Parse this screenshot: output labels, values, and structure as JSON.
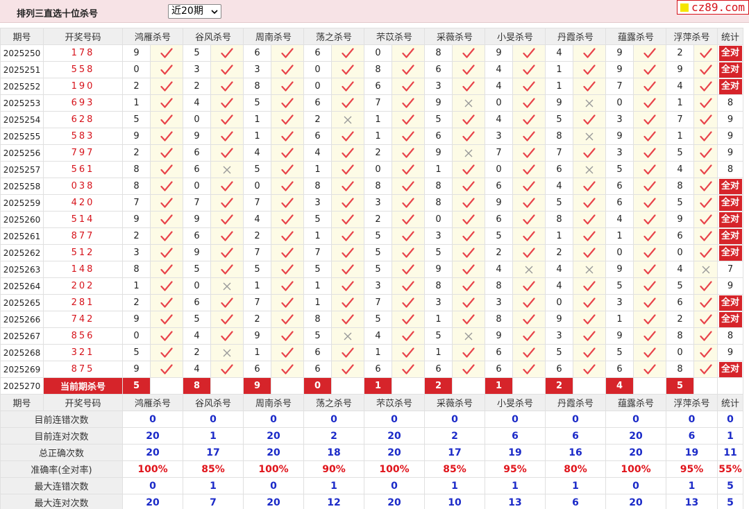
{
  "header": {
    "title": "排列三直选十位杀号",
    "range_selected": "近20期",
    "site_badge": "cz89.com"
  },
  "columns": {
    "period": "期号",
    "winning": "开奖号码",
    "killers": [
      "鸿雁杀号",
      "谷风杀号",
      "周南杀号",
      "荡之杀号",
      "芣苡杀号",
      "采薇杀号",
      "小旻杀号",
      "丹霞杀号",
      "蕴露杀号",
      "浮萍杀号"
    ],
    "stats": "统计"
  },
  "all_right_label": "全对",
  "rows": [
    {
      "period": "2025250",
      "winning": "178",
      "kills": [
        {
          "n": "9",
          "ok": true
        },
        {
          "n": "5",
          "ok": true
        },
        {
          "n": "6",
          "ok": true
        },
        {
          "n": "6",
          "ok": true
        },
        {
          "n": "0",
          "ok": true
        },
        {
          "n": "8",
          "ok": true
        },
        {
          "n": "9",
          "ok": true
        },
        {
          "n": "4",
          "ok": true
        },
        {
          "n": "9",
          "ok": true
        },
        {
          "n": "2",
          "ok": true
        }
      ],
      "stat": "全对"
    },
    {
      "period": "2025251",
      "winning": "558",
      "kills": [
        {
          "n": "0",
          "ok": true
        },
        {
          "n": "3",
          "ok": true
        },
        {
          "n": "3",
          "ok": true
        },
        {
          "n": "0",
          "ok": true
        },
        {
          "n": "8",
          "ok": true
        },
        {
          "n": "6",
          "ok": true
        },
        {
          "n": "4",
          "ok": true
        },
        {
          "n": "1",
          "ok": true
        },
        {
          "n": "9",
          "ok": true
        },
        {
          "n": "9",
          "ok": true
        }
      ],
      "stat": "全对"
    },
    {
      "period": "2025252",
      "winning": "190",
      "kills": [
        {
          "n": "2",
          "ok": true
        },
        {
          "n": "2",
          "ok": true
        },
        {
          "n": "8",
          "ok": true
        },
        {
          "n": "0",
          "ok": true
        },
        {
          "n": "6",
          "ok": true
        },
        {
          "n": "3",
          "ok": true
        },
        {
          "n": "4",
          "ok": true
        },
        {
          "n": "1",
          "ok": true
        },
        {
          "n": "7",
          "ok": true
        },
        {
          "n": "4",
          "ok": true
        }
      ],
      "stat": "全对"
    },
    {
      "period": "2025253",
      "winning": "693",
      "kills": [
        {
          "n": "1",
          "ok": true
        },
        {
          "n": "4",
          "ok": true
        },
        {
          "n": "5",
          "ok": true
        },
        {
          "n": "6",
          "ok": true
        },
        {
          "n": "7",
          "ok": true
        },
        {
          "n": "9",
          "ok": false
        },
        {
          "n": "0",
          "ok": true
        },
        {
          "n": "9",
          "ok": false
        },
        {
          "n": "0",
          "ok": true
        },
        {
          "n": "1",
          "ok": true
        }
      ],
      "stat": "8"
    },
    {
      "period": "2025254",
      "winning": "628",
      "kills": [
        {
          "n": "5",
          "ok": true
        },
        {
          "n": "0",
          "ok": true
        },
        {
          "n": "1",
          "ok": true
        },
        {
          "n": "2",
          "ok": false
        },
        {
          "n": "1",
          "ok": true
        },
        {
          "n": "5",
          "ok": true
        },
        {
          "n": "4",
          "ok": true
        },
        {
          "n": "5",
          "ok": true
        },
        {
          "n": "3",
          "ok": true
        },
        {
          "n": "7",
          "ok": true
        }
      ],
      "stat": "9"
    },
    {
      "period": "2025255",
      "winning": "583",
      "kills": [
        {
          "n": "9",
          "ok": true
        },
        {
          "n": "9",
          "ok": true
        },
        {
          "n": "1",
          "ok": true
        },
        {
          "n": "6",
          "ok": true
        },
        {
          "n": "1",
          "ok": true
        },
        {
          "n": "6",
          "ok": true
        },
        {
          "n": "3",
          "ok": true
        },
        {
          "n": "8",
          "ok": false
        },
        {
          "n": "9",
          "ok": true
        },
        {
          "n": "1",
          "ok": true
        }
      ],
      "stat": "9"
    },
    {
      "period": "2025256",
      "winning": "797",
      "kills": [
        {
          "n": "2",
          "ok": true
        },
        {
          "n": "6",
          "ok": true
        },
        {
          "n": "4",
          "ok": true
        },
        {
          "n": "4",
          "ok": true
        },
        {
          "n": "2",
          "ok": true
        },
        {
          "n": "9",
          "ok": false
        },
        {
          "n": "7",
          "ok": true
        },
        {
          "n": "7",
          "ok": true
        },
        {
          "n": "3",
          "ok": true
        },
        {
          "n": "5",
          "ok": true
        }
      ],
      "stat": "9"
    },
    {
      "period": "2025257",
      "winning": "561",
      "kills": [
        {
          "n": "8",
          "ok": true
        },
        {
          "n": "6",
          "ok": false
        },
        {
          "n": "5",
          "ok": true
        },
        {
          "n": "1",
          "ok": true
        },
        {
          "n": "0",
          "ok": true
        },
        {
          "n": "1",
          "ok": true
        },
        {
          "n": "0",
          "ok": true
        },
        {
          "n": "6",
          "ok": false
        },
        {
          "n": "5",
          "ok": true
        },
        {
          "n": "4",
          "ok": true
        }
      ],
      "stat": "8"
    },
    {
      "period": "2025258",
      "winning": "038",
      "kills": [
        {
          "n": "8",
          "ok": true
        },
        {
          "n": "0",
          "ok": true
        },
        {
          "n": "0",
          "ok": true
        },
        {
          "n": "8",
          "ok": true
        },
        {
          "n": "8",
          "ok": true
        },
        {
          "n": "8",
          "ok": true
        },
        {
          "n": "6",
          "ok": true
        },
        {
          "n": "4",
          "ok": true
        },
        {
          "n": "6",
          "ok": true
        },
        {
          "n": "8",
          "ok": true
        }
      ],
      "stat": "全对"
    },
    {
      "period": "2025259",
      "winning": "420",
      "kills": [
        {
          "n": "7",
          "ok": true
        },
        {
          "n": "7",
          "ok": true
        },
        {
          "n": "7",
          "ok": true
        },
        {
          "n": "3",
          "ok": true
        },
        {
          "n": "3",
          "ok": true
        },
        {
          "n": "8",
          "ok": true
        },
        {
          "n": "9",
          "ok": true
        },
        {
          "n": "5",
          "ok": true
        },
        {
          "n": "6",
          "ok": true
        },
        {
          "n": "5",
          "ok": true
        }
      ],
      "stat": "全对"
    },
    {
      "period": "2025260",
      "winning": "514",
      "kills": [
        {
          "n": "9",
          "ok": true
        },
        {
          "n": "9",
          "ok": true
        },
        {
          "n": "4",
          "ok": true
        },
        {
          "n": "5",
          "ok": true
        },
        {
          "n": "2",
          "ok": true
        },
        {
          "n": "0",
          "ok": true
        },
        {
          "n": "6",
          "ok": true
        },
        {
          "n": "8",
          "ok": true
        },
        {
          "n": "4",
          "ok": true
        },
        {
          "n": "9",
          "ok": true
        }
      ],
      "stat": "全对"
    },
    {
      "period": "2025261",
      "winning": "877",
      "kills": [
        {
          "n": "2",
          "ok": true
        },
        {
          "n": "6",
          "ok": true
        },
        {
          "n": "2",
          "ok": true
        },
        {
          "n": "1",
          "ok": true
        },
        {
          "n": "5",
          "ok": true
        },
        {
          "n": "3",
          "ok": true
        },
        {
          "n": "5",
          "ok": true
        },
        {
          "n": "1",
          "ok": true
        },
        {
          "n": "1",
          "ok": true
        },
        {
          "n": "6",
          "ok": true
        }
      ],
      "stat": "全对"
    },
    {
      "period": "2025262",
      "winning": "512",
      "kills": [
        {
          "n": "3",
          "ok": true
        },
        {
          "n": "9",
          "ok": true
        },
        {
          "n": "7",
          "ok": true
        },
        {
          "n": "7",
          "ok": true
        },
        {
          "n": "5",
          "ok": true
        },
        {
          "n": "5",
          "ok": true
        },
        {
          "n": "2",
          "ok": true
        },
        {
          "n": "2",
          "ok": true
        },
        {
          "n": "0",
          "ok": true
        },
        {
          "n": "0",
          "ok": true
        }
      ],
      "stat": "全对"
    },
    {
      "period": "2025263",
      "winning": "148",
      "kills": [
        {
          "n": "8",
          "ok": true
        },
        {
          "n": "5",
          "ok": true
        },
        {
          "n": "5",
          "ok": true
        },
        {
          "n": "5",
          "ok": true
        },
        {
          "n": "5",
          "ok": true
        },
        {
          "n": "9",
          "ok": true
        },
        {
          "n": "4",
          "ok": false
        },
        {
          "n": "4",
          "ok": false
        },
        {
          "n": "9",
          "ok": true
        },
        {
          "n": "4",
          "ok": false
        }
      ],
      "stat": "7"
    },
    {
      "period": "2025264",
      "winning": "202",
      "kills": [
        {
          "n": "1",
          "ok": true
        },
        {
          "n": "0",
          "ok": false
        },
        {
          "n": "1",
          "ok": true
        },
        {
          "n": "1",
          "ok": true
        },
        {
          "n": "3",
          "ok": true
        },
        {
          "n": "8",
          "ok": true
        },
        {
          "n": "8",
          "ok": true
        },
        {
          "n": "4",
          "ok": true
        },
        {
          "n": "5",
          "ok": true
        },
        {
          "n": "5",
          "ok": true
        }
      ],
      "stat": "9"
    },
    {
      "period": "2025265",
      "winning": "281",
      "kills": [
        {
          "n": "2",
          "ok": true
        },
        {
          "n": "6",
          "ok": true
        },
        {
          "n": "7",
          "ok": true
        },
        {
          "n": "1",
          "ok": true
        },
        {
          "n": "7",
          "ok": true
        },
        {
          "n": "3",
          "ok": true
        },
        {
          "n": "3",
          "ok": true
        },
        {
          "n": "0",
          "ok": true
        },
        {
          "n": "3",
          "ok": true
        },
        {
          "n": "6",
          "ok": true
        }
      ],
      "stat": "全对"
    },
    {
      "period": "2025266",
      "winning": "742",
      "kills": [
        {
          "n": "9",
          "ok": true
        },
        {
          "n": "5",
          "ok": true
        },
        {
          "n": "2",
          "ok": true
        },
        {
          "n": "8",
          "ok": true
        },
        {
          "n": "5",
          "ok": true
        },
        {
          "n": "1",
          "ok": true
        },
        {
          "n": "8",
          "ok": true
        },
        {
          "n": "9",
          "ok": true
        },
        {
          "n": "1",
          "ok": true
        },
        {
          "n": "2",
          "ok": true
        }
      ],
      "stat": "全对"
    },
    {
      "period": "2025267",
      "winning": "856",
      "kills": [
        {
          "n": "0",
          "ok": true
        },
        {
          "n": "4",
          "ok": true
        },
        {
          "n": "9",
          "ok": true
        },
        {
          "n": "5",
          "ok": false
        },
        {
          "n": "4",
          "ok": true
        },
        {
          "n": "5",
          "ok": false
        },
        {
          "n": "9",
          "ok": true
        },
        {
          "n": "3",
          "ok": true
        },
        {
          "n": "9",
          "ok": true
        },
        {
          "n": "8",
          "ok": true
        }
      ],
      "stat": "8"
    },
    {
      "period": "2025268",
      "winning": "321",
      "kills": [
        {
          "n": "5",
          "ok": true
        },
        {
          "n": "2",
          "ok": false
        },
        {
          "n": "1",
          "ok": true
        },
        {
          "n": "6",
          "ok": true
        },
        {
          "n": "1",
          "ok": true
        },
        {
          "n": "1",
          "ok": true
        },
        {
          "n": "6",
          "ok": true
        },
        {
          "n": "5",
          "ok": true
        },
        {
          "n": "5",
          "ok": true
        },
        {
          "n": "0",
          "ok": true
        }
      ],
      "stat": "9"
    },
    {
      "period": "2025269",
      "winning": "875",
      "kills": [
        {
          "n": "9",
          "ok": true
        },
        {
          "n": "4",
          "ok": true
        },
        {
          "n": "6",
          "ok": true
        },
        {
          "n": "6",
          "ok": true
        },
        {
          "n": "6",
          "ok": true
        },
        {
          "n": "6",
          "ok": true
        },
        {
          "n": "6",
          "ok": true
        },
        {
          "n": "6",
          "ok": true
        },
        {
          "n": "6",
          "ok": true
        },
        {
          "n": "8",
          "ok": true
        }
      ],
      "stat": "全对"
    }
  ],
  "current": {
    "period": "2025270",
    "label": "当前期杀号",
    "kills": [
      "5",
      "8",
      "9",
      "0",
      "1",
      "2",
      "1",
      "2",
      "4",
      "5"
    ]
  },
  "summary": [
    {
      "label": "目前连错次数",
      "values": [
        "0",
        "0",
        "0",
        "0",
        "0",
        "0",
        "0",
        "0",
        "0",
        "0"
      ],
      "stat": "0",
      "pct": false
    },
    {
      "label": "目前连对次数",
      "values": [
        "20",
        "1",
        "20",
        "2",
        "20",
        "2",
        "6",
        "6",
        "20",
        "6"
      ],
      "stat": "1",
      "pct": false
    },
    {
      "label": "总正确次数",
      "values": [
        "20",
        "17",
        "20",
        "18",
        "20",
        "17",
        "19",
        "16",
        "20",
        "19"
      ],
      "stat": "11",
      "pct": false
    },
    {
      "label": "准确率(全对率)",
      "values": [
        "100%",
        "85%",
        "100%",
        "90%",
        "100%",
        "85%",
        "95%",
        "80%",
        "100%",
        "95%"
      ],
      "stat": "55%",
      "pct": true
    },
    {
      "label": "最大连错次数",
      "values": [
        "0",
        "1",
        "0",
        "1",
        "0",
        "1",
        "1",
        "1",
        "0",
        "1"
      ],
      "stat": "5",
      "pct": false
    },
    {
      "label": "最大连对次数",
      "values": [
        "20",
        "7",
        "20",
        "12",
        "20",
        "10",
        "13",
        "6",
        "20",
        "13"
      ],
      "stat": "5",
      "pct": false
    }
  ],
  "colors": {
    "accent_red": "#d6242a",
    "check_red": "#e8434a",
    "cross_gray": "#999999",
    "summary_blue": "#1b2ac8",
    "header_pink": "#f7e3e6"
  }
}
